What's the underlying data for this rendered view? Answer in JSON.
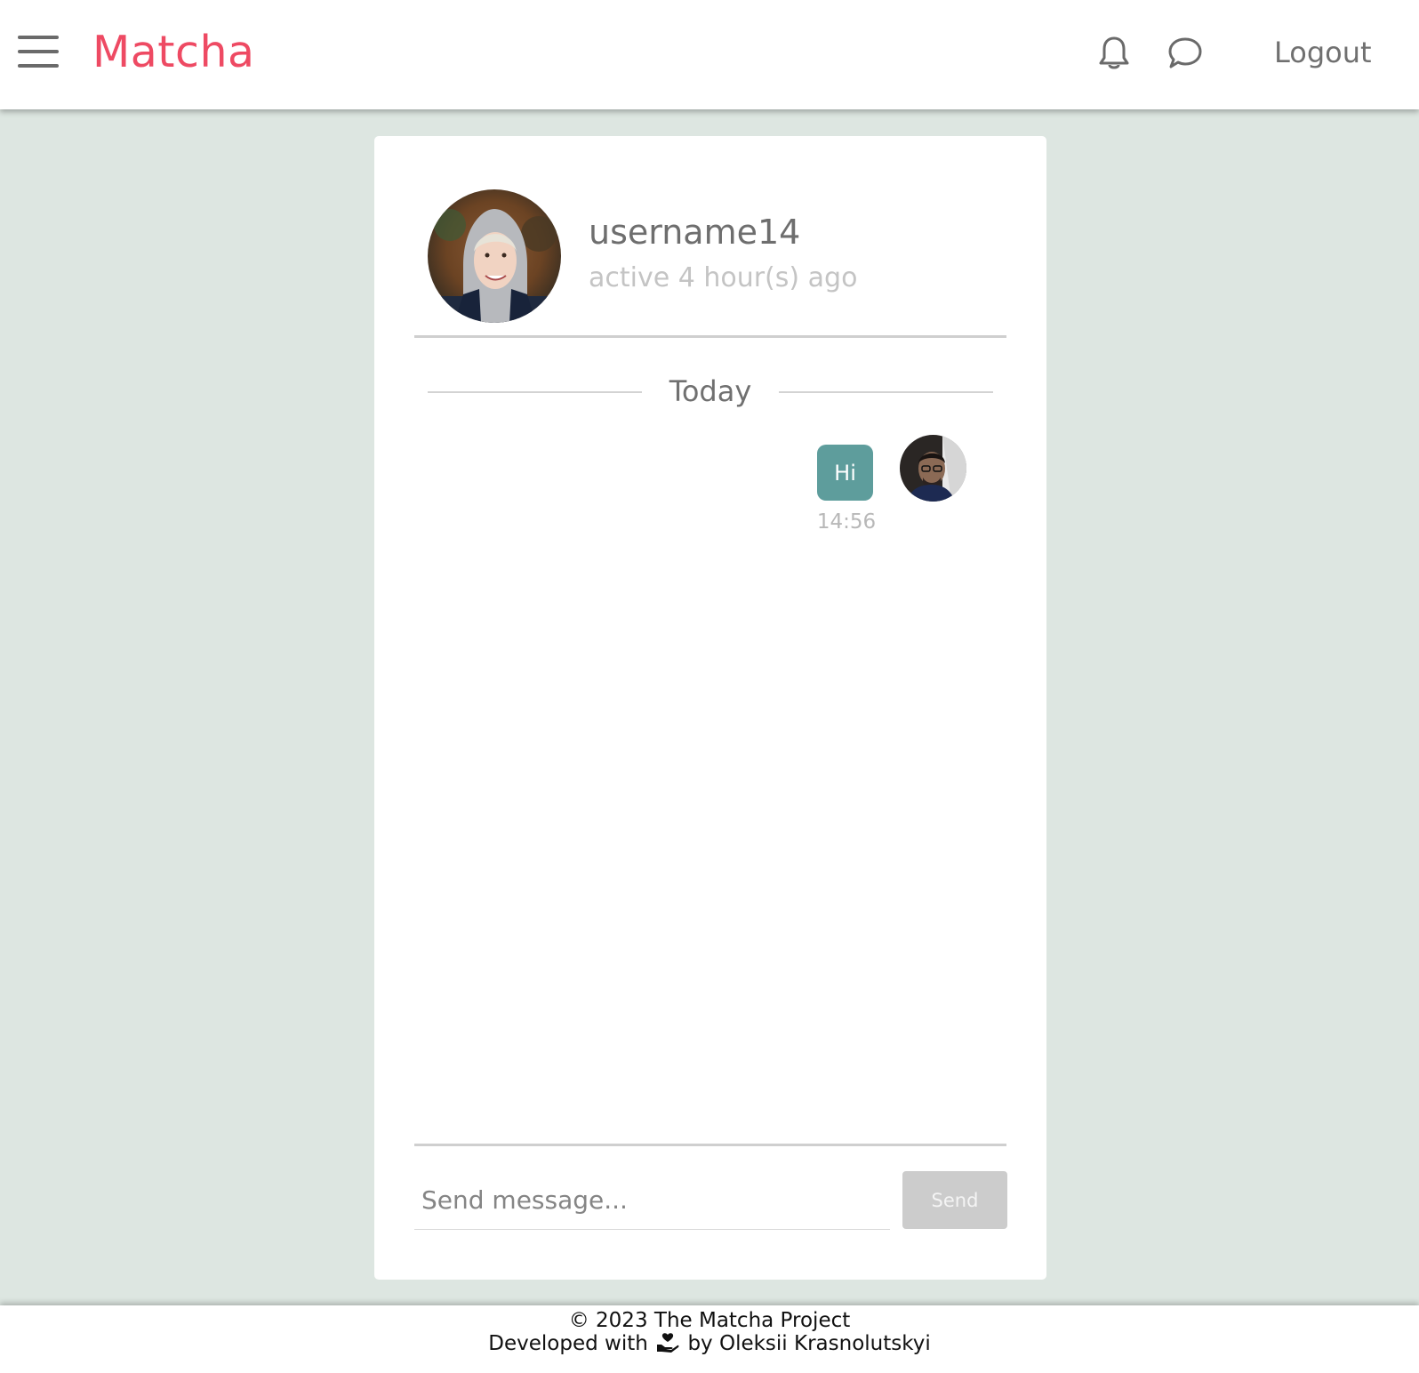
{
  "header": {
    "menu_icon": "hamburger-menu-icon",
    "brand": "Matcha",
    "brand_color": "#ee4a63",
    "notifications_icon": "bell-icon",
    "messages_icon": "chat-bubble-icon",
    "logout_label": "Logout"
  },
  "chat": {
    "contact": {
      "username": "username14",
      "status": "active 4 hour(s) ago"
    },
    "day_separator": "Today",
    "messages": [
      {
        "text": "Hi",
        "time": "14:56",
        "from": "me"
      }
    ],
    "bubble_color": "#5e9d9c",
    "composer": {
      "placeholder": "Send message...",
      "value": "",
      "send_label": "Send"
    }
  },
  "footer": {
    "copyright": "© 2023 The Matcha Project",
    "developed_prefix": "Developed with",
    "developed_icon": "hand-heart-icon",
    "developed_suffix": "by Oleksii Krasnolutskyi"
  },
  "colors": {
    "background": "#dde6e1",
    "card": "#ffffff",
    "send_button_disabled": "#cccccc"
  }
}
